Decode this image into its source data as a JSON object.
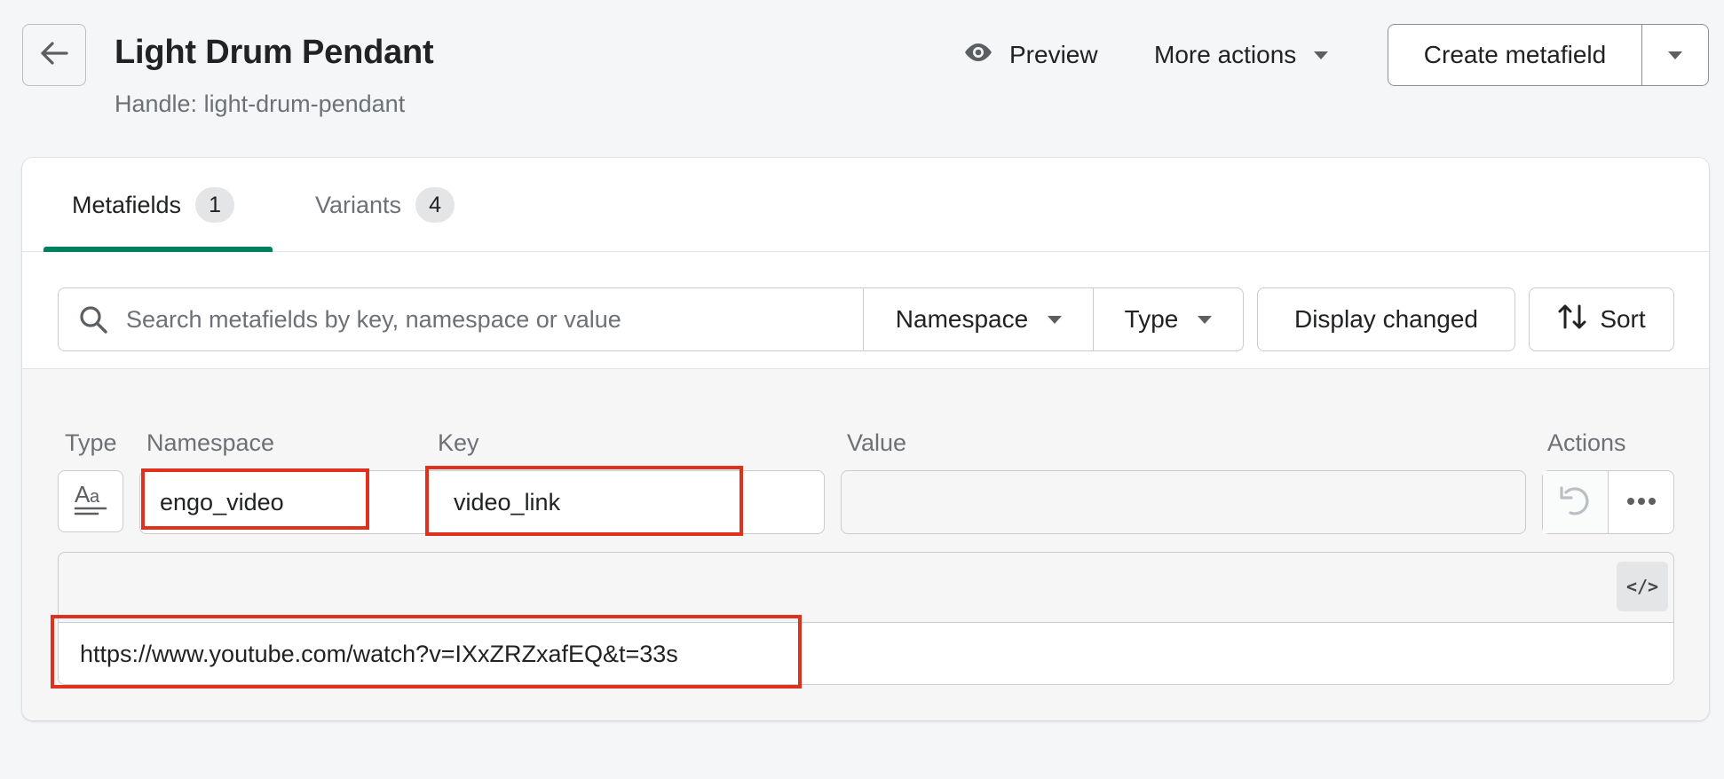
{
  "header": {
    "title": "Light Drum Pendant",
    "subtitle": "Handle: light-drum-pendant",
    "preview_label": "Preview",
    "more_actions_label": "More actions",
    "create_label": "Create metafield"
  },
  "tabs": [
    {
      "label": "Metafields",
      "count": "1",
      "active": true
    },
    {
      "label": "Variants",
      "count": "4",
      "active": false
    }
  ],
  "filters": {
    "search_placeholder": "Search metafields by key, namespace or value",
    "namespace_label": "Namespace",
    "type_label": "Type",
    "display_changed_label": "Display changed",
    "sort_label": "Sort"
  },
  "columns": {
    "type": "Type",
    "namespace": "Namespace",
    "key": "Key",
    "value": "Value",
    "actions": "Actions"
  },
  "metafield": {
    "namespace": "engo_video",
    "key": "video_link",
    "value": "",
    "editor_value": "https://www.youtube.com/watch?v=IXxZRZxafEQ&t=33s",
    "code_toggle": "</>"
  },
  "colors": {
    "accent": "#008060",
    "highlight": "#e0301e",
    "background": "#f5f6f8"
  },
  "icons": {
    "back": "arrow-left-icon",
    "preview": "eye-icon",
    "search": "search-icon",
    "sort": "sort-arrows-icon",
    "type": "text-type-icon",
    "undo": "undo-icon",
    "more": "horizontal-dots-icon"
  }
}
